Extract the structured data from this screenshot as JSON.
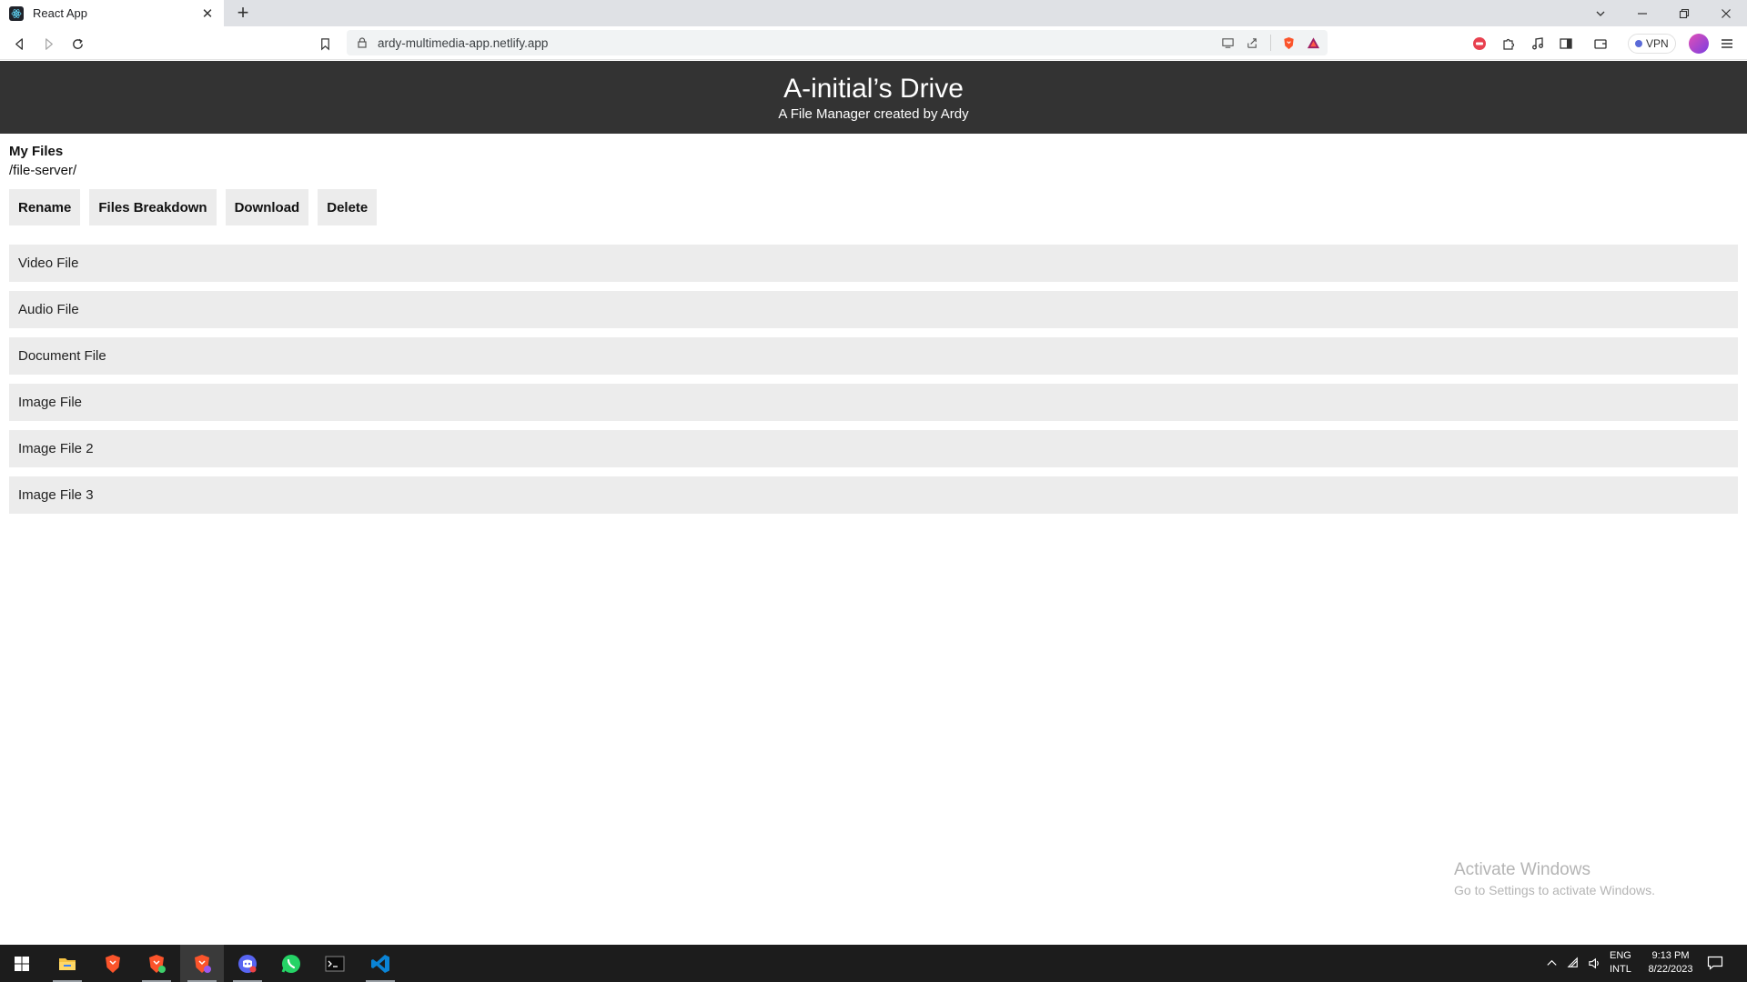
{
  "browser": {
    "tab_title": "React App",
    "tab_close": "✕",
    "new_tab": "+",
    "url": "ardy-multimedia-app.netlify.app",
    "vpn_label": "VPN"
  },
  "header": {
    "title": "A-initial’s Drive",
    "subtitle": "A File Manager created by Ardy",
    "background": "#333333"
  },
  "main": {
    "section_title": "My Files",
    "path": "/file-server/",
    "actions": [
      {
        "label": "Rename"
      },
      {
        "label": "Files Breakdown"
      },
      {
        "label": "Download"
      },
      {
        "label": "Delete"
      }
    ],
    "files": [
      {
        "name": "Video File"
      },
      {
        "name": "Audio File"
      },
      {
        "name": "Document File"
      },
      {
        "name": "Image File"
      },
      {
        "name": "Image File 2"
      },
      {
        "name": "Image File 3"
      }
    ]
  },
  "watermark": {
    "title": "Activate Windows",
    "subtitle": "Go to Settings to activate Windows."
  },
  "taskbar": {
    "apps": [
      "windows-start-icon",
      "file-explorer-icon",
      "brave-browser-icon",
      "brave-beta-icon",
      "brave-nightly-icon",
      "discord-icon",
      "whatsapp-icon",
      "terminal-icon",
      "vscode-icon"
    ],
    "language": "ENG",
    "keyboard": "INTL",
    "time": "9:13 PM",
    "date": "8/22/2023"
  }
}
